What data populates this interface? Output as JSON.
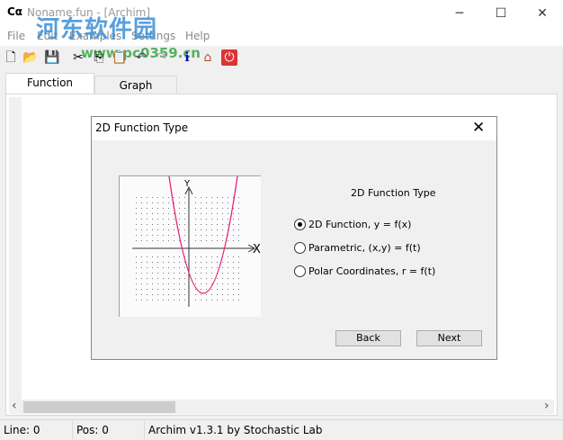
{
  "window": {
    "title": "Noname.fun - [Archim]",
    "app_icon": "Cα",
    "minimize": "─",
    "maximize": "☐",
    "close": "✕"
  },
  "watermark": {
    "text": "河东软件园",
    "url": "www.pc0359.cn"
  },
  "menu": [
    "File",
    "Edit",
    "Examples",
    "Settings",
    "Help"
  ],
  "toolbar": [
    {
      "icon": "new-file-icon",
      "glyph": "🗋"
    },
    {
      "icon": "open-folder-icon",
      "glyph": "📂"
    },
    {
      "icon": "save-icon",
      "glyph": "💾"
    },
    {
      "icon": "cut-icon",
      "glyph": "✂"
    },
    {
      "icon": "copy-icon",
      "glyph": "⎘"
    },
    {
      "icon": "paste-icon",
      "glyph": "📋"
    },
    {
      "icon": "undo-icon",
      "glyph": "↶"
    },
    {
      "icon": "redo-icon",
      "glyph": "↷"
    },
    {
      "icon": "info-icon",
      "glyph": "ℹ"
    },
    {
      "icon": "home-icon",
      "glyph": "⌂"
    },
    {
      "icon": "power-icon",
      "glyph": "⏻"
    }
  ],
  "tabs": [
    {
      "label": "Function",
      "active": true
    },
    {
      "label": "Graph",
      "active": false
    }
  ],
  "status": {
    "line": "Line: 0",
    "pos": "Pos: 0",
    "about": "Archim v1.3.1 by Stochastic Lab"
  },
  "dialog": {
    "title": "2D Function Type",
    "close": "✕",
    "group_title": "2D Function Type",
    "options": [
      {
        "label": "2D Function, y = f(x)",
        "selected": true
      },
      {
        "label": "Parametric, (x,y) = f(t)",
        "selected": false
      },
      {
        "label": "Polar Coordinates, r = f(t)",
        "selected": false
      }
    ],
    "back": "Back",
    "next": "Next",
    "preview": {
      "x_label": "X",
      "y_label": "Y",
      "curve_color": "#e8207a"
    }
  },
  "scroll": {
    "left": "‹",
    "right": "›"
  }
}
